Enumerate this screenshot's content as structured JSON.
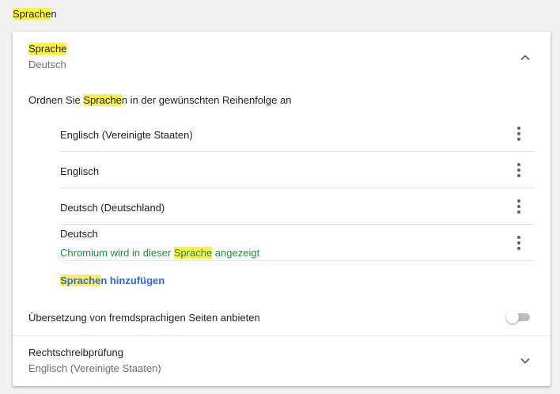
{
  "section": {
    "title_highlight": "Sprache",
    "title_rest": "n"
  },
  "language_section": {
    "title": "Sprache",
    "current": "Deutsch",
    "order_label_before": "Ordnen Sie ",
    "order_label_highlight": "Sprache",
    "order_label_after": "n in der gewünschten Reihenfolge an",
    "languages": [
      {
        "name": "Englisch (Vereinigte Staaten)"
      },
      {
        "name": "Englisch"
      },
      {
        "name": "Deutsch (Deutschland)"
      },
      {
        "name": "Deutsch",
        "note_before": "Chromium wird in dieser ",
        "note_highlight": "Sprache",
        "note_after": " angezeigt"
      }
    ],
    "add_highlight": "Sprache",
    "add_rest": "n hinzufügen"
  },
  "translate": {
    "label": "Übersetzung von fremdsprachigen Seiten anbieten",
    "enabled": false
  },
  "spellcheck": {
    "title": "Rechtschreibprüfung",
    "language": "Englisch (Vereinigte Staaten)"
  },
  "icons": {
    "collapse": "chevron-up-icon",
    "expand": "chevron-down-icon",
    "menu": "more-vert-icon"
  },
  "colors": {
    "highlight": "#fbf24f",
    "link": "#3367d6",
    "note": "#1e8e3e"
  }
}
